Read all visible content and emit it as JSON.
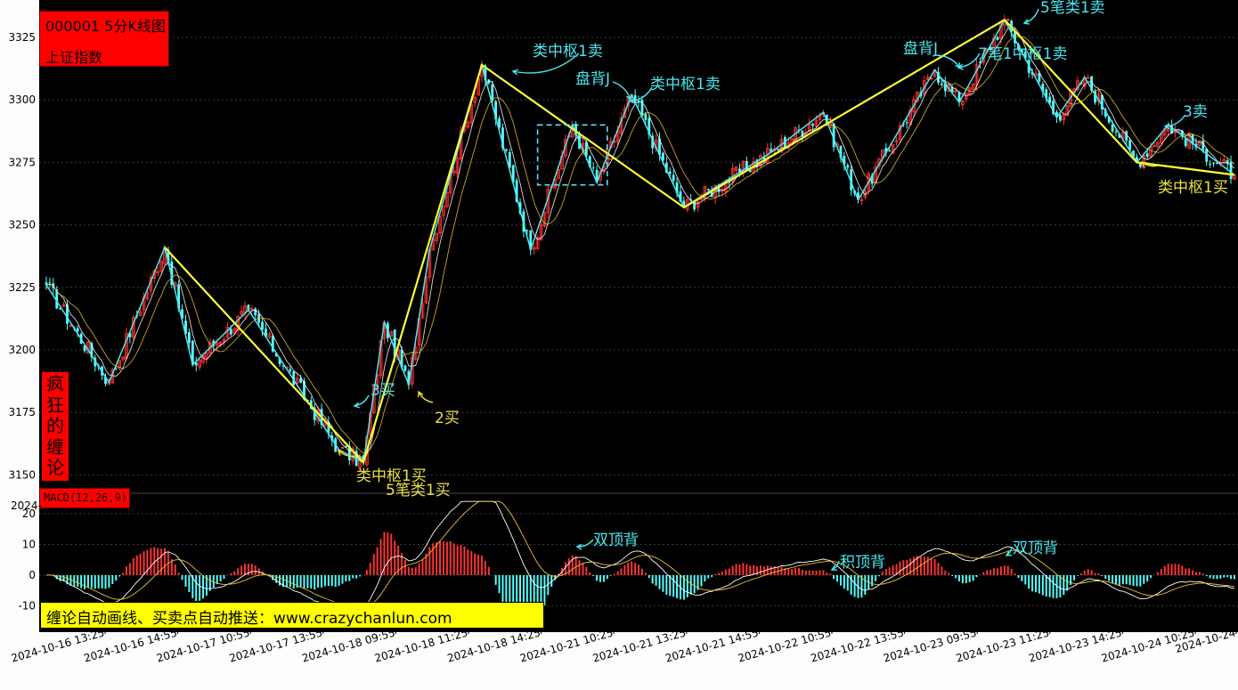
{
  "header": {
    "code_title": "000001 5分K线图",
    "index_name": "上证指数"
  },
  "brand": {
    "chars": [
      "疯",
      "狂",
      "的",
      "缠",
      "论"
    ]
  },
  "macd": {
    "label": "MACD(12,26,9)",
    "stray_label": "2024-"
  },
  "promo": {
    "text": "缠论自动画线、买卖点自动推送：www.crazychanlun.com"
  },
  "annotations": [
    {
      "text": "类中枢1卖",
      "color": "cyan"
    },
    {
      "text": "盘背J",
      "color": "cyan"
    },
    {
      "text": "类中枢1卖",
      "color": "cyan"
    },
    {
      "text": "盘背J",
      "color": "cyan"
    },
    {
      "text": "7笔1中枢1卖",
      "color": "cyan"
    },
    {
      "text": "5笔类1卖",
      "color": "cyan"
    },
    {
      "text": "3卖",
      "color": "cyan"
    },
    {
      "text": "类中枢1买",
      "color": "yellow"
    },
    {
      "text": "3买",
      "color": "cyan"
    },
    {
      "text": "2买",
      "color": "yellow"
    },
    {
      "text": "类中枢1买",
      "color": "yellow"
    },
    {
      "text": "5笔类1买",
      "color": "yellow"
    },
    {
      "text": "双顶背",
      "color": "cyan"
    },
    {
      "text": "积顶背",
      "color": "cyan"
    },
    {
      "text": "双顶背",
      "color": "cyan"
    }
  ],
  "colors": {
    "background": "#000000",
    "up_candle": "#ff3232",
    "down_candle": "#54ffff",
    "bi_line": "#4ee6f0",
    "segment_line": "#ffff33",
    "annotation_cyan": "#48e8f0",
    "annotation_yellow": "#e8e040",
    "axis_text": "#000000"
  },
  "chart_data": [
    {
      "type": "candlestick",
      "title": "000001 5分K线图",
      "ylim": [
        3145,
        3330
      ],
      "yticks": [
        3325,
        3300,
        3275,
        3250,
        3225,
        3200,
        3175,
        3150
      ],
      "x_labels": [
        "2024-10-16 13:25",
        "2024-10-16 14:55",
        "2024-10-17 10:55",
        "2024-10-17 13:55",
        "2024-10-18 09:55",
        "2024-10-18 11:25",
        "2024-10-18 14:25",
        "2024-10-21 10:25",
        "2024-10-21 13:25",
        "2024-10-21 14:55",
        "2024-10-22 10:55",
        "2024-10-22 13:55",
        "2024-10-23 09:55",
        "2024-10-23 11:25",
        "2024-10-23 14:25",
        "2024-10-24 10:25",
        "2024-10-24"
      ],
      "bi_points": [
        {
          "i": 0,
          "v": 3226
        },
        {
          "i": 18,
          "v": 3187
        },
        {
          "i": 34,
          "v": 3241
        },
        {
          "i": 42,
          "v": 3194
        },
        {
          "i": 58,
          "v": 3216
        },
        {
          "i": 84,
          "v": 3160
        },
        {
          "i": 91,
          "v": 3155
        },
        {
          "i": 97,
          "v": 3211
        },
        {
          "i": 104,
          "v": 3186
        },
        {
          "i": 110,
          "v": 3240
        },
        {
          "i": 125,
          "v": 3314
        },
        {
          "i": 139,
          "v": 3240
        },
        {
          "i": 151,
          "v": 3290
        },
        {
          "i": 158,
          "v": 3267
        },
        {
          "i": 168,
          "v": 3302
        },
        {
          "i": 183,
          "v": 3257
        },
        {
          "i": 208,
          "v": 3279
        },
        {
          "i": 223,
          "v": 3295
        },
        {
          "i": 233,
          "v": 3260
        },
        {
          "i": 255,
          "v": 3312
        },
        {
          "i": 262,
          "v": 3299
        },
        {
          "i": 275,
          "v": 3332
        },
        {
          "i": 290,
          "v": 3293
        },
        {
          "i": 298,
          "v": 3309
        },
        {
          "i": 313,
          "v": 3275
        },
        {
          "i": 322,
          "v": 3290
        },
        {
          "i": 341,
          "v": 3270
        }
      ],
      "segment_points": [
        {
          "i": 34,
          "v": 3241
        },
        {
          "i": 91,
          "v": 3155
        },
        {
          "i": 125,
          "v": 3314
        },
        {
          "i": 183,
          "v": 3257
        },
        {
          "i": 275,
          "v": 3332
        },
        {
          "i": 313,
          "v": 3275
        },
        {
          "i": 341,
          "v": 3270
        }
      ],
      "zhongshu_box": {
        "i_start": 141,
        "i_end": 161,
        "v_low": 3266,
        "v_high": 3290
      }
    },
    {
      "type": "bar",
      "title": "MACD(12,26,9)",
      "ylim": [
        -14,
        25
      ],
      "yticks": [
        20,
        10,
        0,
        -10
      ]
    }
  ]
}
